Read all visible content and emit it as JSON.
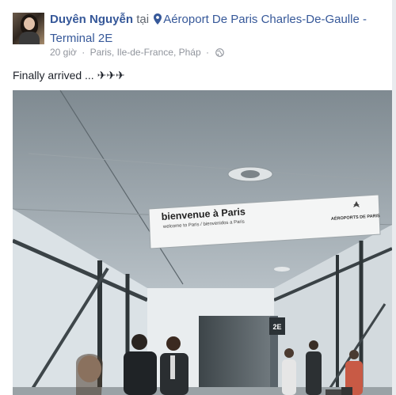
{
  "post": {
    "author": "Duyên Nguyễn",
    "at_word": "tại",
    "location": "Aéroport De Paris Charles-De-Gaulle - Terminal 2E",
    "time": "20 giờ",
    "dot": "·",
    "place": "Paris, Ile-de-France, Pháp",
    "caption": "Finally arrived ... ✈✈✈",
    "location_icon": "map-pin-icon",
    "privacy_icon": "globe-icon"
  },
  "photo": {
    "sign_title": "bienvenue à Paris",
    "sign_subtitle": "welcome to Paris / bienvenidos a Paris",
    "sign_brand": "AÉROPORTS DE PARIS",
    "gate_label": "2E"
  },
  "colors": {
    "link": "#365899",
    "meta": "#90949c",
    "text": "#1d2129"
  }
}
